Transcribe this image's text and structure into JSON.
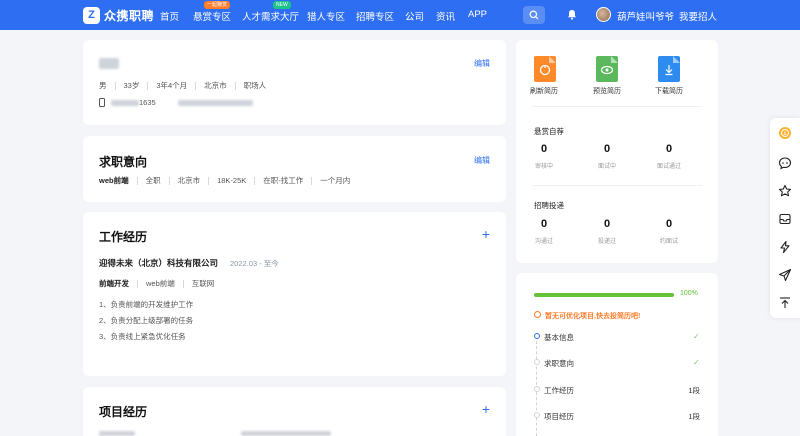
{
  "brand": {
    "logo_glyph": "Z",
    "name": "众携职聘",
    "color": "#2e6ef2"
  },
  "nav": {
    "items": [
      {
        "label": "首页"
      },
      {
        "label": "悬赏专区",
        "badge": "一起赚赏"
      },
      {
        "label": "人才需求大厅",
        "badge": "NEW"
      },
      {
        "label": "猎人专区"
      },
      {
        "label": "招聘专区"
      },
      {
        "label": "公司"
      },
      {
        "label": "资讯"
      },
      {
        "label": "APP"
      }
    ],
    "user_name": "葫芦娃叫爷爷",
    "recruit_label": "我要招人",
    "icons": [
      "search-icon",
      "bell-icon"
    ]
  },
  "profile": {
    "gender": "男",
    "age": "33岁",
    "experience": "3年4个月",
    "city": "北京市",
    "identity": "职场人",
    "phone_suffix": "1635",
    "edit_label": "编辑"
  },
  "intention": {
    "title": "求职意向",
    "edit_label": "编辑",
    "position": "web前端",
    "job_type": "全职",
    "city": "北京市",
    "salary": "18K-25K",
    "status": "在职-找工作",
    "arrival": "一个月内"
  },
  "work": {
    "title": "工作经历",
    "company": "迎得未来（北京）科技有限公司",
    "period": "2022.03 - 至今",
    "dept": "前端开发",
    "position": "web前端",
    "industry": "互联网",
    "duties": [
      "1、负责前端的开发维护工作",
      "2、负责分配上级部署的任务",
      "3、负责线上紧急优化任务"
    ]
  },
  "project": {
    "title": "项目经历"
  },
  "resume_actions": [
    {
      "label": "刷新简历",
      "color": "#ff8a2a",
      "icon": "refresh-resume-icon"
    },
    {
      "label": "预览简历",
      "color": "#5cb85c",
      "icon": "preview-resume-icon"
    },
    {
      "label": "下载简历",
      "color": "#2e8cf0",
      "icon": "download-resume-icon"
    }
  ],
  "bounty": {
    "title": "悬赏自荐",
    "stats": [
      {
        "value": "0",
        "label": "审核中"
      },
      {
        "value": "0",
        "label": "面试中"
      },
      {
        "value": "0",
        "label": "面试通过"
      }
    ]
  },
  "delivery": {
    "title": "招聘投递",
    "stats": [
      {
        "value": "0",
        "label": "沟通过"
      },
      {
        "value": "0",
        "label": "投递过"
      },
      {
        "value": "0",
        "label": "约面试"
      }
    ]
  },
  "completion": {
    "percent": 100,
    "percent_label": "100%",
    "hint": "暂无可优化项目,快去投简历吧!",
    "steps": [
      {
        "name": "基本信息",
        "value": "✓"
      },
      {
        "name": "求职意向",
        "value": "✓"
      },
      {
        "name": "工作经历",
        "value": "1段"
      },
      {
        "name": "项目经历",
        "value": "1段"
      }
    ]
  },
  "sidebar_icons": [
    "coin-icon",
    "chat-icon",
    "star-icon",
    "inbox-icon",
    "flash-icon",
    "send-icon",
    "back-to-top-icon"
  ]
}
